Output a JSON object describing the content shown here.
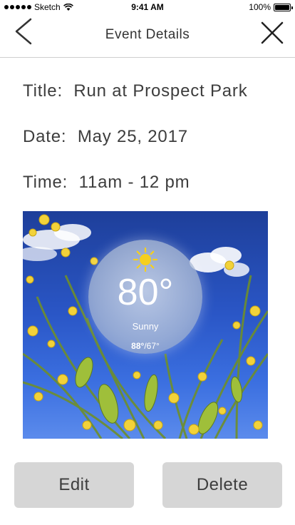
{
  "status_bar": {
    "carrier": "Sketch",
    "time": "9:41 AM",
    "battery": "100%"
  },
  "nav": {
    "title": "Event Details",
    "back_icon": "chevron-left-icon",
    "close_icon": "close-icon"
  },
  "event": {
    "title_label": "Title:",
    "title_value": "Run at Prospect Park",
    "date_label": "Date:",
    "date_value": "May 25, 2017",
    "time_label": "Time:",
    "time_value": "11am - 12 pm"
  },
  "weather": {
    "temperature": "80°",
    "condition": "Sunny",
    "high": "88°",
    "low": "/67°",
    "icon": "sun-icon",
    "sky_color": "#2a56c6",
    "flower_color": "#f2d23a"
  },
  "actions": {
    "edit_label": "Edit",
    "delete_label": "Delete"
  }
}
